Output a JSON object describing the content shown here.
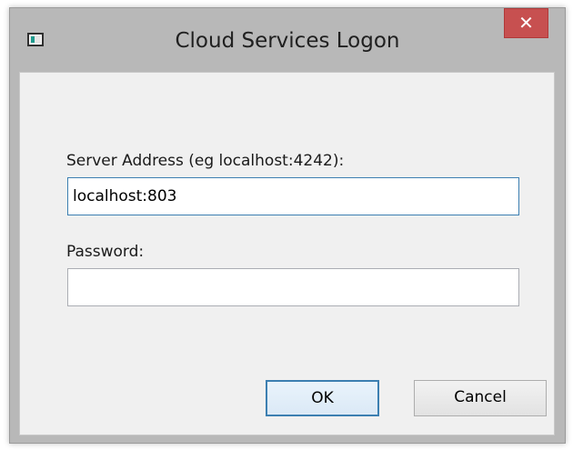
{
  "window": {
    "title": "Cloud Services Logon",
    "close_glyph": "✕"
  },
  "form": {
    "server_label": "Server Address (eg localhost:4242):",
    "server_value": "localhost:803",
    "password_label": "Password:",
    "password_value": ""
  },
  "buttons": {
    "ok_label": "OK",
    "cancel_label": "Cancel"
  },
  "icons": {
    "app": "application-window-icon",
    "close": "close-icon"
  },
  "colors": {
    "close_button": "#c75050",
    "focus_border": "#3c7fb1",
    "client_background": "#f0f0f0",
    "frame": "#b8b8b8"
  }
}
